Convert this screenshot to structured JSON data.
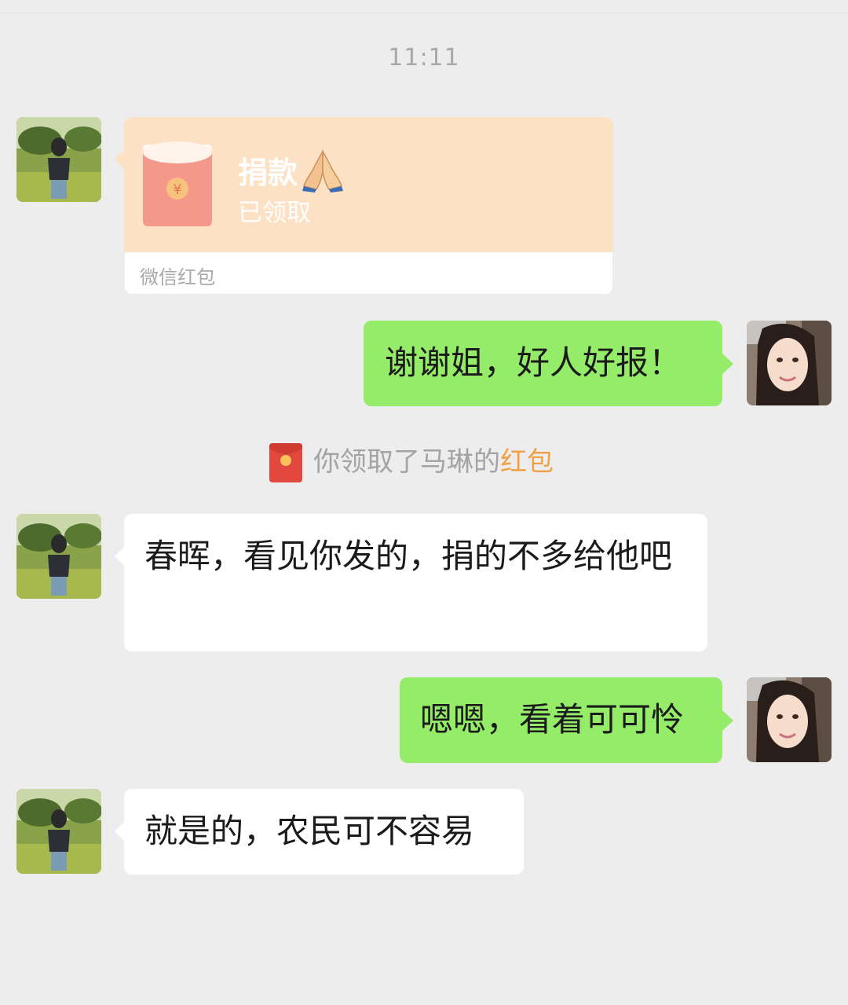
{
  "timestamp": "11:11",
  "red_packet": {
    "title": "捐款",
    "emoji": "folded-hands-emoji",
    "status": "已领取",
    "brand": "微信红包",
    "card_color": "#fde1c4",
    "envelope_color": "#f5988c"
  },
  "messages": [
    {
      "from": "other",
      "text": "春晖，看见你发的，捐的不多给他吧"
    },
    {
      "from": "me",
      "text": "谢谢姐，好人好报！"
    },
    {
      "from": "me",
      "text": "嗯嗯，看着可可怜"
    },
    {
      "from": "other",
      "text": "就是的，农民可不容易"
    }
  ],
  "notice": {
    "prefix": "你领取了马琳的",
    "link": "红包",
    "link_color": "#f1a046",
    "icon": "red-packet-icon"
  },
  "colors": {
    "background": "#ededed",
    "my_bubble": "#95ec69",
    "their_bubble": "#ffffff"
  }
}
